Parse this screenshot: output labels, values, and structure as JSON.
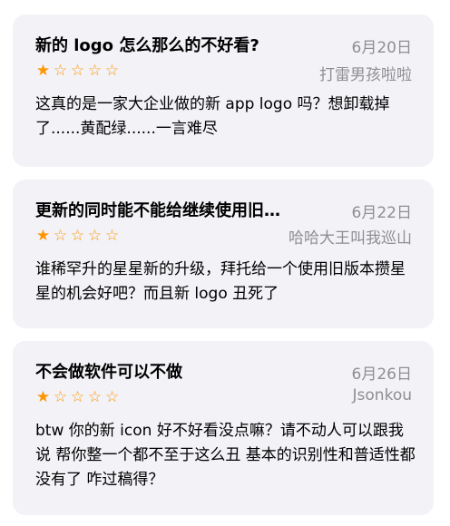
{
  "reviews": [
    {
      "title": "新的 logo 怎么那么的不好看?",
      "date": "6月20日",
      "author": "打雷男孩啦啦",
      "rating": 1,
      "max_rating": 5,
      "body": "这真的是一家大企业做的新 app logo 吗？想卸载掉了......黄配绿......一言难尽"
    },
    {
      "title": "更新的同时能不能给继续使用旧…",
      "date": "6月22日",
      "author": "哈哈大王叫我巡山",
      "rating": 1,
      "max_rating": 5,
      "body": "谁稀罕升的星星新的升级，拜托给一个使用旧版本攒星星的机会好吧？而且新 logo 丑死了"
    },
    {
      "title": "不会做软件可以不做",
      "date": "6月26日",
      "author": "Jsonkou",
      "rating": 1,
      "max_rating": 5,
      "body": "btw 你的新 icon 好不好看没点嘛？请不动人可以跟我说 帮你整一个都不至于这么丑 基本的识别性和普适性都没有了 咋过稿得？"
    }
  ],
  "colors": {
    "star": "#ff9500",
    "card_bg": "#f2f2f7",
    "secondary_text": "#8e8e93"
  }
}
